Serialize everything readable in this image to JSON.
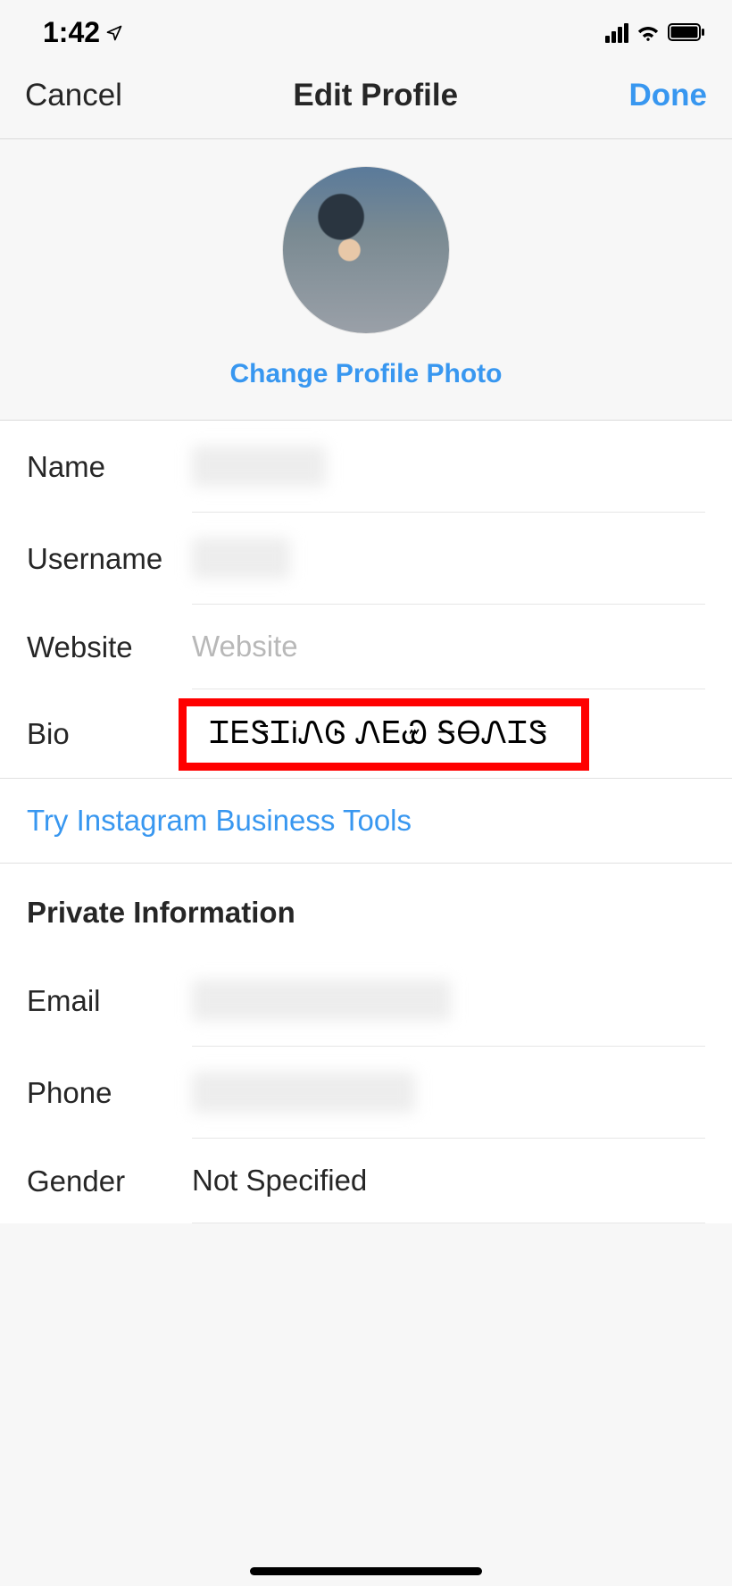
{
  "statusBar": {
    "time": "1:42"
  },
  "nav": {
    "cancel": "Cancel",
    "title": "Edit Profile",
    "done": "Done"
  },
  "photo": {
    "changeLabel": "Change Profile Photo"
  },
  "fields": {
    "name": {
      "label": "Name",
      "value": ""
    },
    "username": {
      "label": "Username",
      "value": ""
    },
    "website": {
      "label": "Website",
      "placeholder": "Website",
      "value": ""
    },
    "bio": {
      "label": "Bio",
      "value": "ᏆᎬᏕᏆᎥᏁᎶ ᏁᎬᏯ ᎦᎾᏁᏆᏕ"
    }
  },
  "businessLink": "Try Instagram Business Tools",
  "privateSection": {
    "header": "Private Information",
    "email": {
      "label": "Email",
      "value": ""
    },
    "phone": {
      "label": "Phone",
      "value": ""
    },
    "gender": {
      "label": "Gender",
      "value": "Not Specified"
    }
  }
}
